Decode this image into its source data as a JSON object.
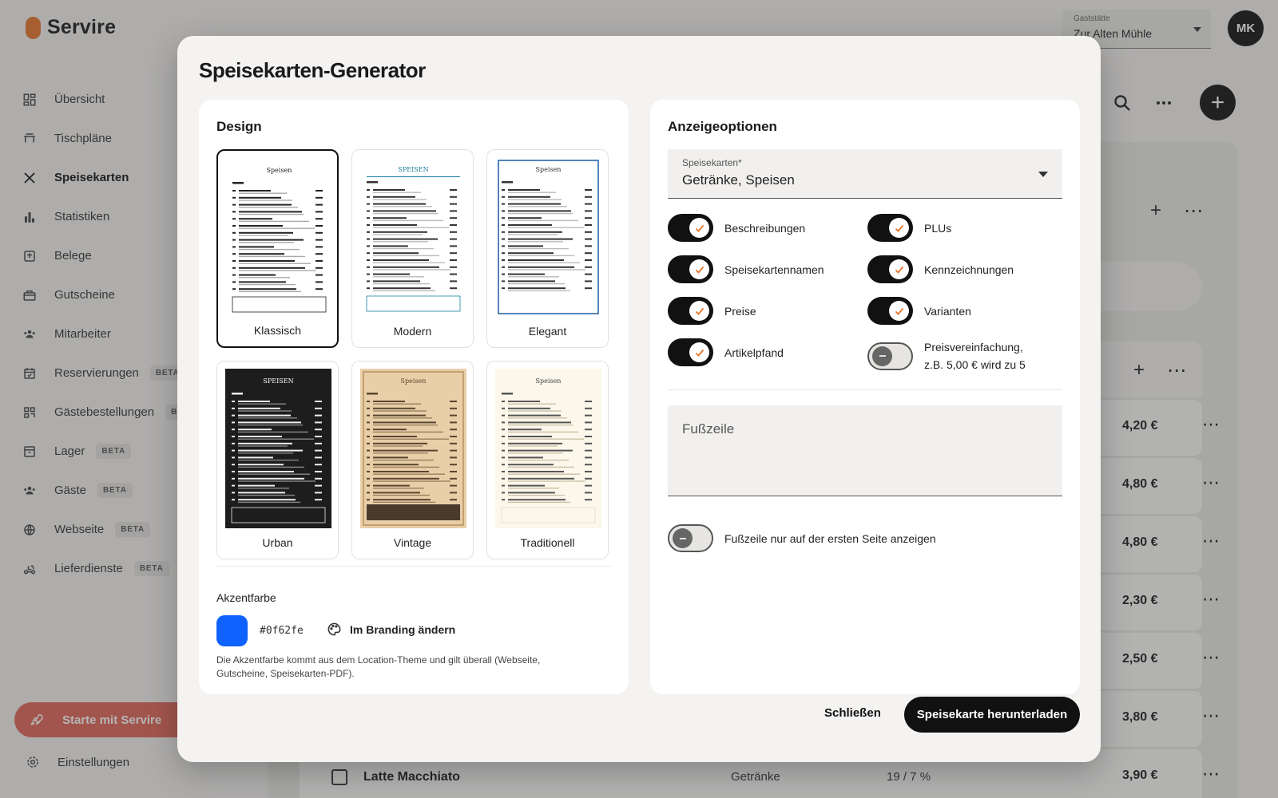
{
  "app": {
    "brand": "Servire",
    "nav": [
      {
        "label": "Übersicht",
        "icon": "dashboard-icon",
        "beta": ""
      },
      {
        "label": "Tischpläne",
        "icon": "table-icon",
        "beta": ""
      },
      {
        "label": "Speisekarten",
        "icon": "cutlery-icon",
        "beta": "",
        "active": true
      },
      {
        "label": "Statistiken",
        "icon": "bar-chart-icon",
        "beta": ""
      },
      {
        "label": "Belege",
        "icon": "receipt-icon",
        "beta": ""
      },
      {
        "label": "Gutscheine",
        "icon": "gift-icon",
        "beta": ""
      },
      {
        "label": "Mitarbeiter",
        "icon": "people-icon",
        "beta": ""
      },
      {
        "label": "Reservierungen",
        "icon": "calendar-icon",
        "beta": "BETA"
      },
      {
        "label": "Gästebestellungen",
        "icon": "qr-icon",
        "beta": "BETA"
      },
      {
        "label": "Lager",
        "icon": "box-icon",
        "beta": "BETA"
      },
      {
        "label": "Gäste",
        "icon": "guests-icon",
        "beta": "BETA"
      },
      {
        "label": "Webseite",
        "icon": "globe-icon",
        "beta": "BETA"
      },
      {
        "label": "Lieferdienste",
        "icon": "delivery-icon",
        "beta": "BETA"
      }
    ],
    "start_button": "Starte mit Servire",
    "settings": "Einstellungen",
    "location_label": "Gaststätte",
    "location_value": "Zur Alten Mühle",
    "avatar_initials": "MK",
    "rows": [
      {
        "price": "4,20 €"
      },
      {
        "price": "4,80 €"
      },
      {
        "price": "4,80 €"
      },
      {
        "price": "2,30 €"
      },
      {
        "price": "2,50 €"
      },
      {
        "price": "3,80 €"
      },
      {
        "name": "Latte Macchiato",
        "category": "Getränke",
        "tax": "19 / 7 %",
        "price": "3,90 €"
      }
    ]
  },
  "modal": {
    "title": "Speisekarten-Generator",
    "design": {
      "heading": "Design",
      "options": [
        {
          "label": "Klassisch",
          "selected": true
        },
        {
          "label": "Modern",
          "selected": false
        },
        {
          "label": "Elegant",
          "selected": false
        },
        {
          "label": "Urban",
          "selected": false
        },
        {
          "label": "Vintage",
          "selected": false
        },
        {
          "label": "Traditionell",
          "selected": false
        }
      ],
      "accent_heading": "Akzentfarbe",
      "accent_color": "#0f62fe",
      "accent_hex": "#0f62fe",
      "branding_link": "Im Branding ändern",
      "accent_note": "Die Akzentfarbe kommt aus dem Location-Theme und gilt überall (Webseite, Gutscheine, Speisekarten-PDF)."
    },
    "options": {
      "heading": "Anzeigeoptionen",
      "menus_label": "Speisekarten*",
      "menus_value": "Getränke, Speisen",
      "toggles": [
        {
          "label": "Beschreibungen",
          "on": true
        },
        {
          "label": "PLUs",
          "on": true
        },
        {
          "label": "Speisekartennamen",
          "on": true
        },
        {
          "label": "Kennzeichnungen",
          "on": true
        },
        {
          "label": "Preise",
          "on": true
        },
        {
          "label": "Varianten",
          "on": true
        },
        {
          "label": "Artikelpfand",
          "on": true
        },
        {
          "label": "Preisvereinfachung,",
          "label2": "z.B. 5,00 € wird zu 5",
          "on": false
        }
      ],
      "footer_placeholder": "Fußzeile",
      "footer_first_page_label": "Fußzeile nur auf der ersten Seite anzeigen",
      "footer_first_page_on": false
    },
    "close_label": "Schließen",
    "download_label": "Speisekarte herunterladen"
  },
  "colors": {
    "accent": "#0f62fe",
    "check": "#e8742a",
    "brand": "#e8742a"
  }
}
